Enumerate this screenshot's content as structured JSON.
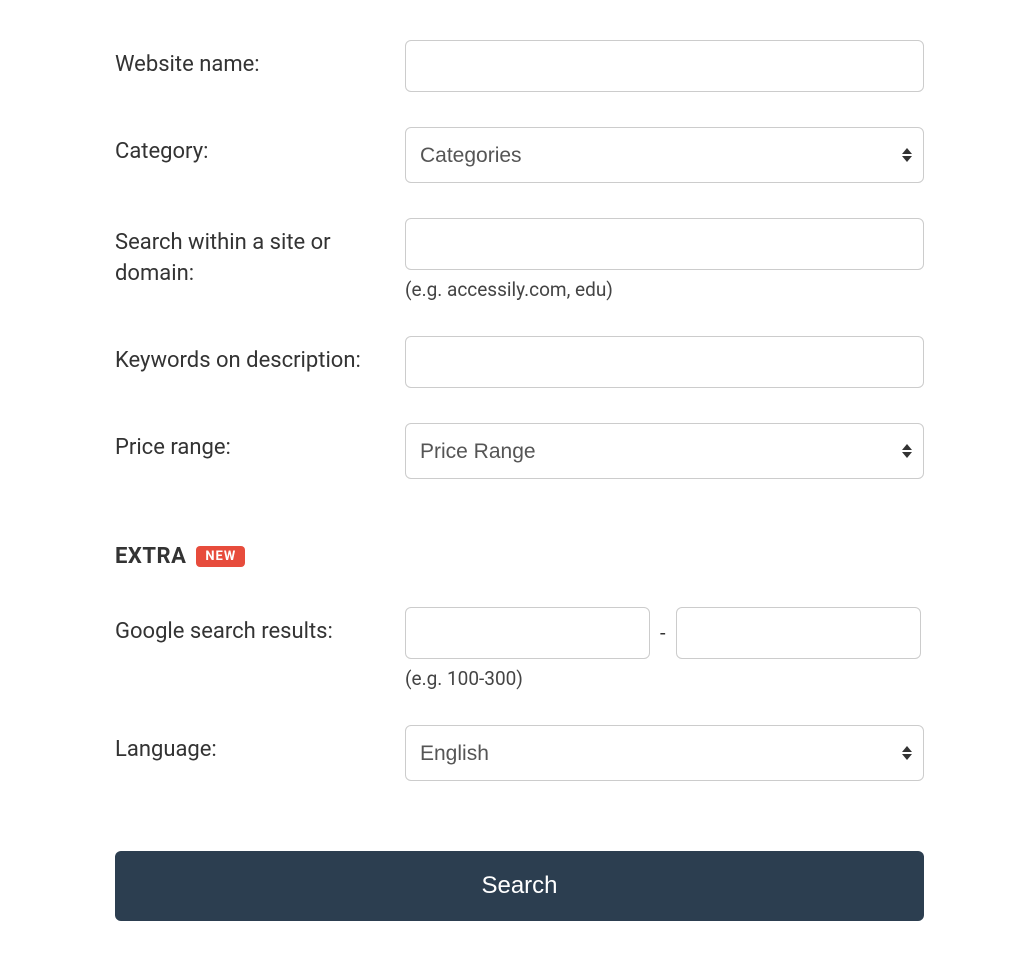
{
  "form": {
    "website_name": {
      "label": "Website name:",
      "value": ""
    },
    "category": {
      "label": "Category:",
      "selected": "Categories"
    },
    "site_domain": {
      "label": "Search within a site or domain:",
      "value": "",
      "hint": "(e.g. accessily.com, edu)"
    },
    "keywords": {
      "label": "Keywords on description:",
      "value": ""
    },
    "price_range": {
      "label": "Price range:",
      "selected": "Price Range"
    }
  },
  "extra": {
    "title": "EXTRA",
    "badge": "NEW",
    "google_results": {
      "label": "Google search results:",
      "from": "",
      "to": "",
      "separator": "-",
      "hint": "(e.g. 100-300)"
    },
    "language": {
      "label": "Language:",
      "selected": "English"
    }
  },
  "actions": {
    "search_label": "Search"
  }
}
